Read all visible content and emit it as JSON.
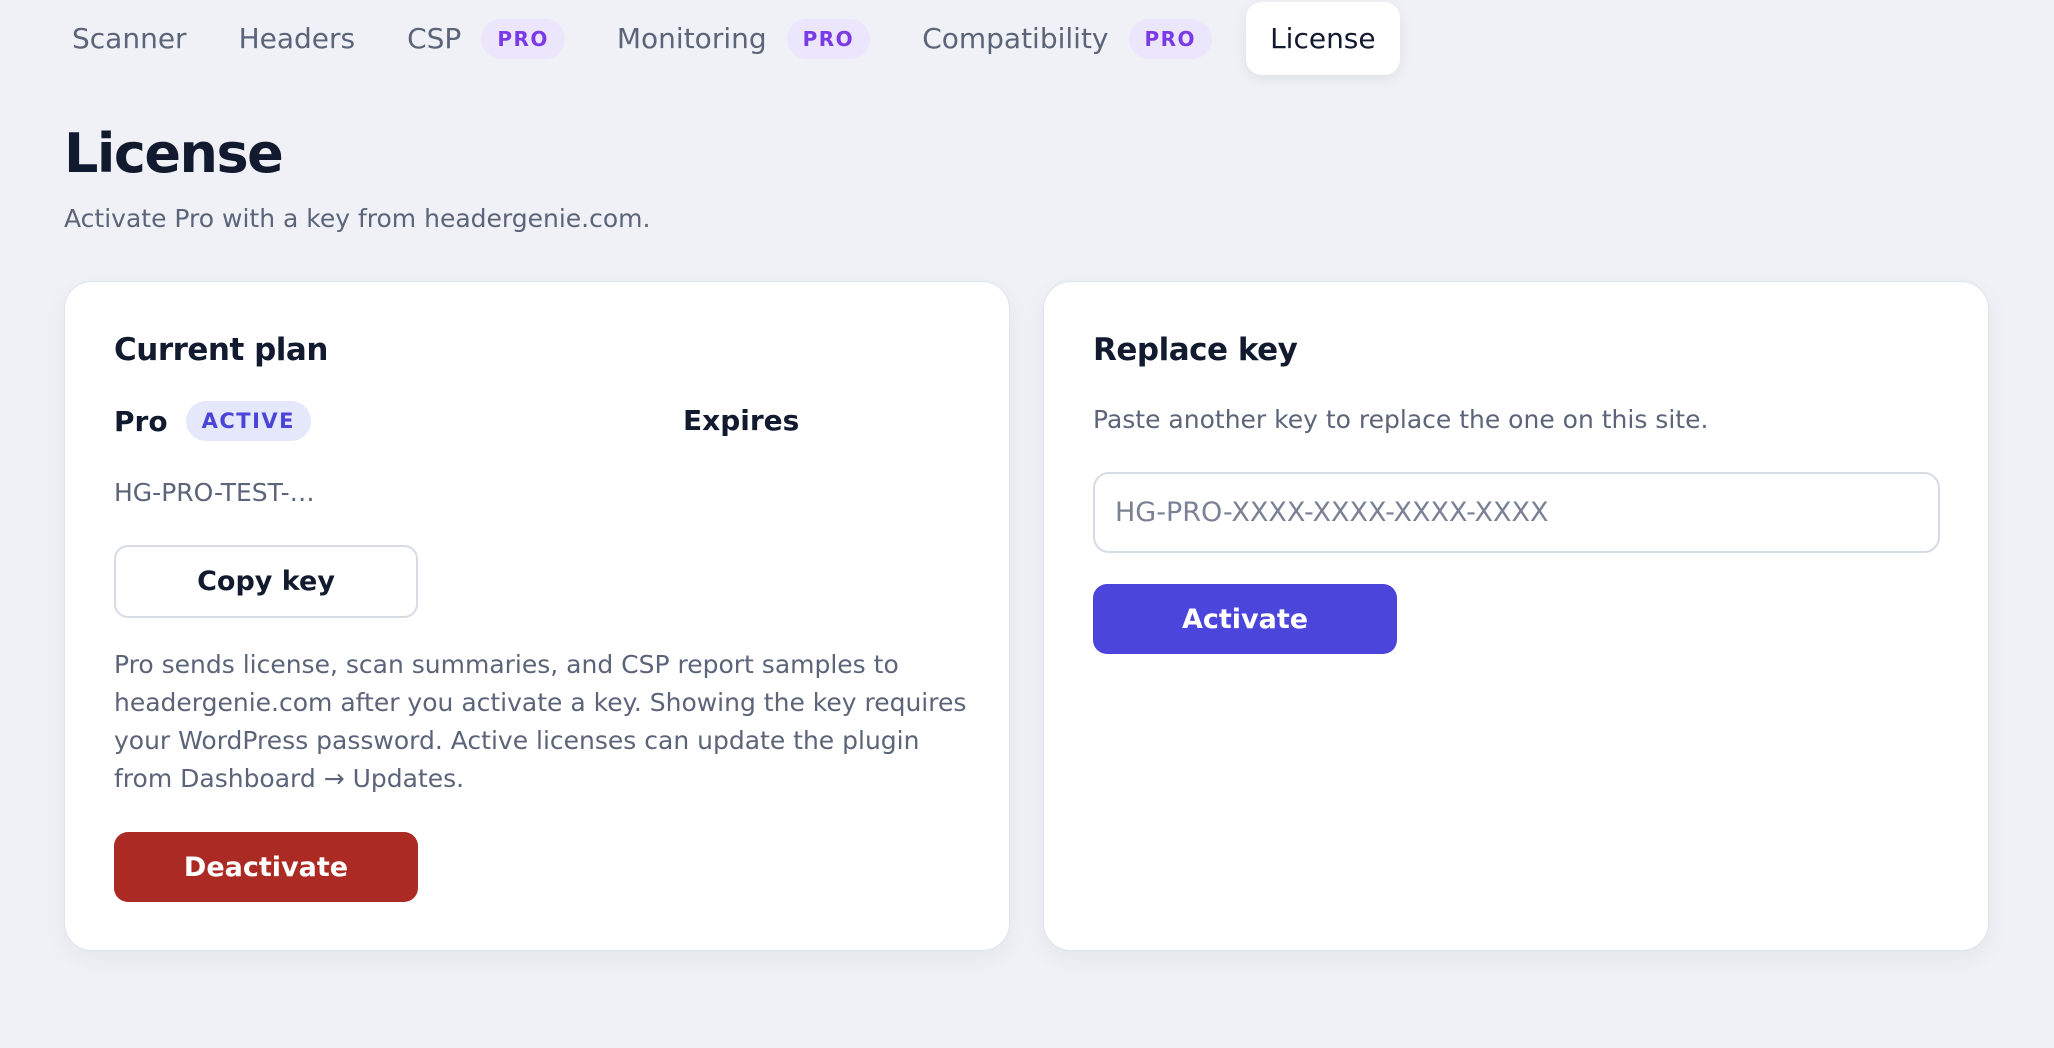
{
  "tabs": [
    {
      "label": "Scanner",
      "badge": ""
    },
    {
      "label": "Headers",
      "badge": ""
    },
    {
      "label": "CSP",
      "badge": "PRO"
    },
    {
      "label": "Monitoring",
      "badge": "PRO"
    },
    {
      "label": "Compatibility",
      "badge": "PRO"
    },
    {
      "label": "License",
      "badge": "",
      "active": true
    }
  ],
  "page": {
    "title": "License",
    "subtitle": "Activate Pro with a key from headergenie.com."
  },
  "current_plan": {
    "title": "Current plan",
    "plan_name": "Pro",
    "status_badge": "ACTIVE",
    "expires_label": "Expires",
    "key_masked": "HG-PRO-TEST-…",
    "copy_button": "Copy key",
    "info_text": "Pro sends license, scan summaries, and CSP report samples to headergenie.com after you activate a key. Showing the key requires your WordPress password. Active licenses can update the plugin from Dashboard → Updates.",
    "deactivate_button": "Deactivate"
  },
  "replace_key": {
    "title": "Replace key",
    "description": "Paste another key to replace the one on this site.",
    "input_value": "",
    "input_placeholder": "HG-PRO-XXXX-XXXX-XXXX-XXXX",
    "activate_button": "Activate"
  },
  "colors": {
    "background": "#eff1f6",
    "accent": "#4c45dc",
    "danger": "#ab2b24",
    "pro_badge_text": "#7a3ae6",
    "pro_badge_bg": "#ebe6fb",
    "active_badge_text": "#4a44d8",
    "active_badge_bg": "#e5e7fb"
  }
}
